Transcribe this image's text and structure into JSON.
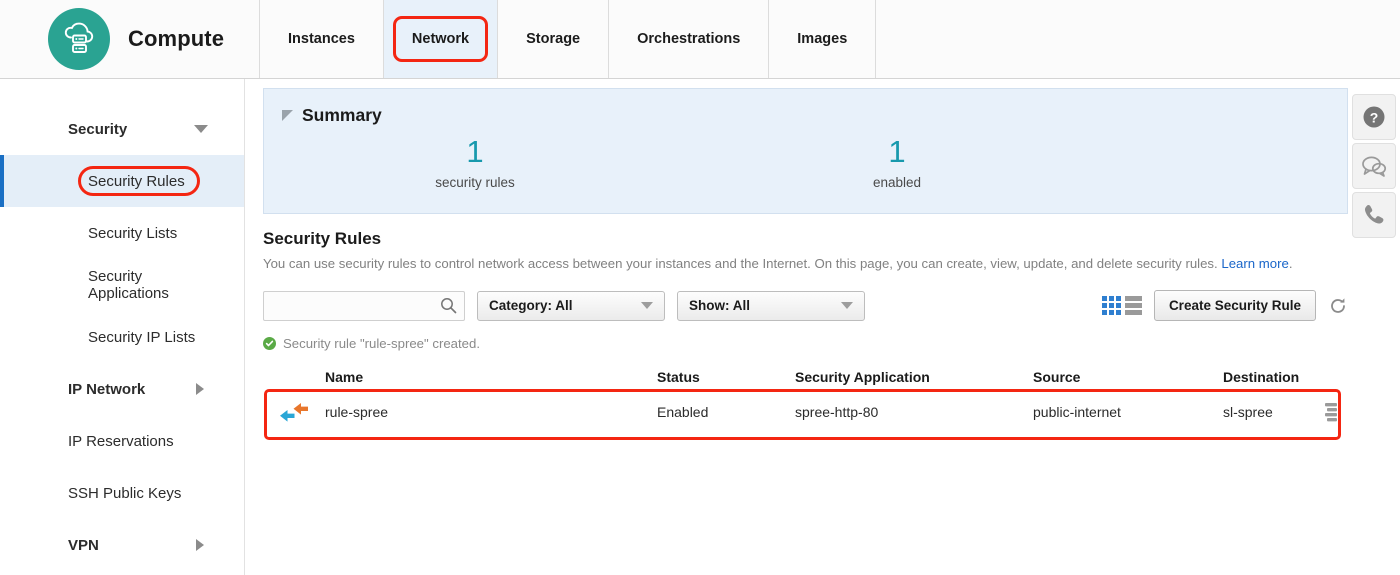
{
  "header": {
    "brand_title": "Compute",
    "logo_icon": "cloud-server-icon",
    "logo_color": "#2aa392",
    "tabs": [
      {
        "label": "Instances",
        "active": false,
        "annotated": false
      },
      {
        "label": "Network",
        "active": true,
        "annotated": true
      },
      {
        "label": "Storage",
        "active": false,
        "annotated": false
      },
      {
        "label": "Orchestrations",
        "active": false,
        "annotated": false
      },
      {
        "label": "Images",
        "active": false,
        "annotated": false
      }
    ]
  },
  "sidebar": {
    "items": [
      {
        "label": "Security",
        "type": "group",
        "caret": "chevron-down-icon",
        "active": false,
        "annotated": false
      },
      {
        "label": "Security Rules",
        "type": "child",
        "caret": "",
        "active": true,
        "annotated": true
      },
      {
        "label": "Security Lists",
        "type": "child",
        "caret": "",
        "active": false,
        "annotated": false
      },
      {
        "label": "Security Applications",
        "type": "child",
        "caret": "",
        "active": false,
        "annotated": false
      },
      {
        "label": "Security IP Lists",
        "type": "child",
        "caret": "",
        "active": false,
        "annotated": false
      },
      {
        "label": "IP Network",
        "type": "group",
        "caret": "chevron-right-icon",
        "active": false,
        "annotated": false
      },
      {
        "label": "IP Reservations",
        "type": "item",
        "caret": "",
        "active": false,
        "annotated": false
      },
      {
        "label": "SSH Public Keys",
        "type": "item",
        "caret": "",
        "active": false,
        "annotated": false
      },
      {
        "label": "VPN",
        "type": "group",
        "caret": "chevron-right-icon",
        "active": false,
        "annotated": false
      }
    ]
  },
  "summary": {
    "title": "Summary",
    "collapse_icon": "triangle-collapse-icon",
    "stats": [
      {
        "value": "1",
        "label": "security rules"
      },
      {
        "value": "1",
        "label": "enabled"
      }
    ],
    "value_color": "#1799ad",
    "background": "#e8f1fa"
  },
  "section": {
    "title": "Security Rules",
    "description": "You can use security rules to control network access between your instances and the Internet. On this page, you can create, view, update, and delete security rules. ",
    "link_text": "Learn more",
    "description_tail": "."
  },
  "toolbar": {
    "search_value": "",
    "search_placeholder": "",
    "search_icon": "search-icon",
    "category_filter": "Category: All",
    "show_filter": "Show: All",
    "view_toggle_icon": "grid-list-view-icon",
    "create_button": "Create Security Rule",
    "refresh_icon": "refresh-icon"
  },
  "notice": {
    "icon": "success-check-icon",
    "text": "Security rule \"rule-spree\" created.",
    "color": "#5aaa46"
  },
  "table": {
    "columns": [
      "Name",
      "Status",
      "Security Application",
      "Source",
      "Destination"
    ],
    "rows": [
      {
        "direction_icon": "bidirectional-arrows-icon",
        "name": "rule-spree",
        "status": "Enabled",
        "security_application": "spree-http-80",
        "source": "public-internet",
        "destination": "sl-spree",
        "menu_icon": "row-menu-icon",
        "annotated": true
      }
    ]
  },
  "help_rail": {
    "buttons": [
      {
        "icon": "help-question-icon",
        "name": "help"
      },
      {
        "icon": "chat-bubble-icon",
        "name": "chat"
      },
      {
        "icon": "phone-icon",
        "name": "call"
      }
    ]
  },
  "annotation": {
    "color": "#f42612"
  }
}
